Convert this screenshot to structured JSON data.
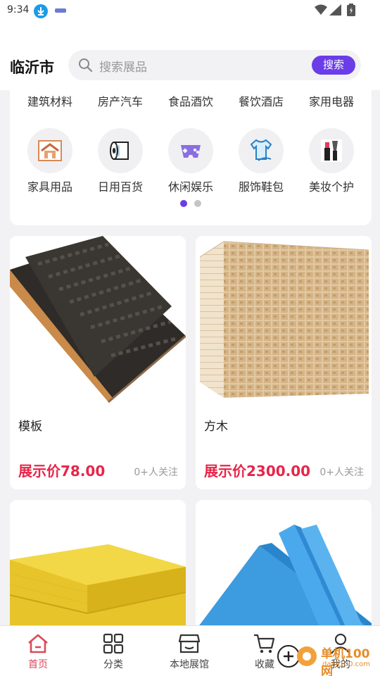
{
  "status_bar": {
    "time": "9:34"
  },
  "header": {
    "city": "临沂市",
    "search_placeholder": "搜索展品",
    "search_button": "搜索"
  },
  "categories_row1": [
    "建筑材料",
    "房产汽车",
    "食品酒饮",
    "餐饮酒店",
    "家用电器"
  ],
  "categories_row2": [
    {
      "label": "家具用品",
      "icon": "furniture-icon"
    },
    {
      "label": "日用百货",
      "icon": "tissue-roll-icon"
    },
    {
      "label": "休闲娱乐",
      "icon": "gamepad-icon"
    },
    {
      "label": "服饰鞋包",
      "icon": "tshirt-icon"
    },
    {
      "label": "美妆个护",
      "icon": "cosmetics-icon"
    }
  ],
  "pager": {
    "active_index": 0,
    "count": 2
  },
  "products": [
    {
      "name": "模板",
      "price": "展示价78.00",
      "follow": "0+人关注",
      "image": "formwork-board-image"
    },
    {
      "name": "方木",
      "price": "展示价2300.00",
      "follow": "0+人关注",
      "image": "timber-stack-image"
    },
    {
      "name": "",
      "price": "",
      "follow": "",
      "image": "yellow-insulation-image"
    },
    {
      "name": "",
      "price": "",
      "follow": "",
      "image": "blue-foam-board-image"
    }
  ],
  "tabbar": [
    {
      "label": "首页",
      "icon": "home-icon",
      "active": true
    },
    {
      "label": "分类",
      "icon": "grid-icon",
      "active": false
    },
    {
      "label": "本地展馆",
      "icon": "store-icon",
      "active": false
    },
    {
      "label": "收藏",
      "icon": "cart-icon",
      "active": false
    },
    {
      "label": "我的",
      "icon": "user-icon",
      "active": false
    }
  ],
  "watermark": {
    "line1": "单机100网",
    "line2": "danji100.com"
  },
  "colors": {
    "accent": "#6a3de8",
    "price": "#e8254a",
    "active_tab": "#d94a5a"
  }
}
